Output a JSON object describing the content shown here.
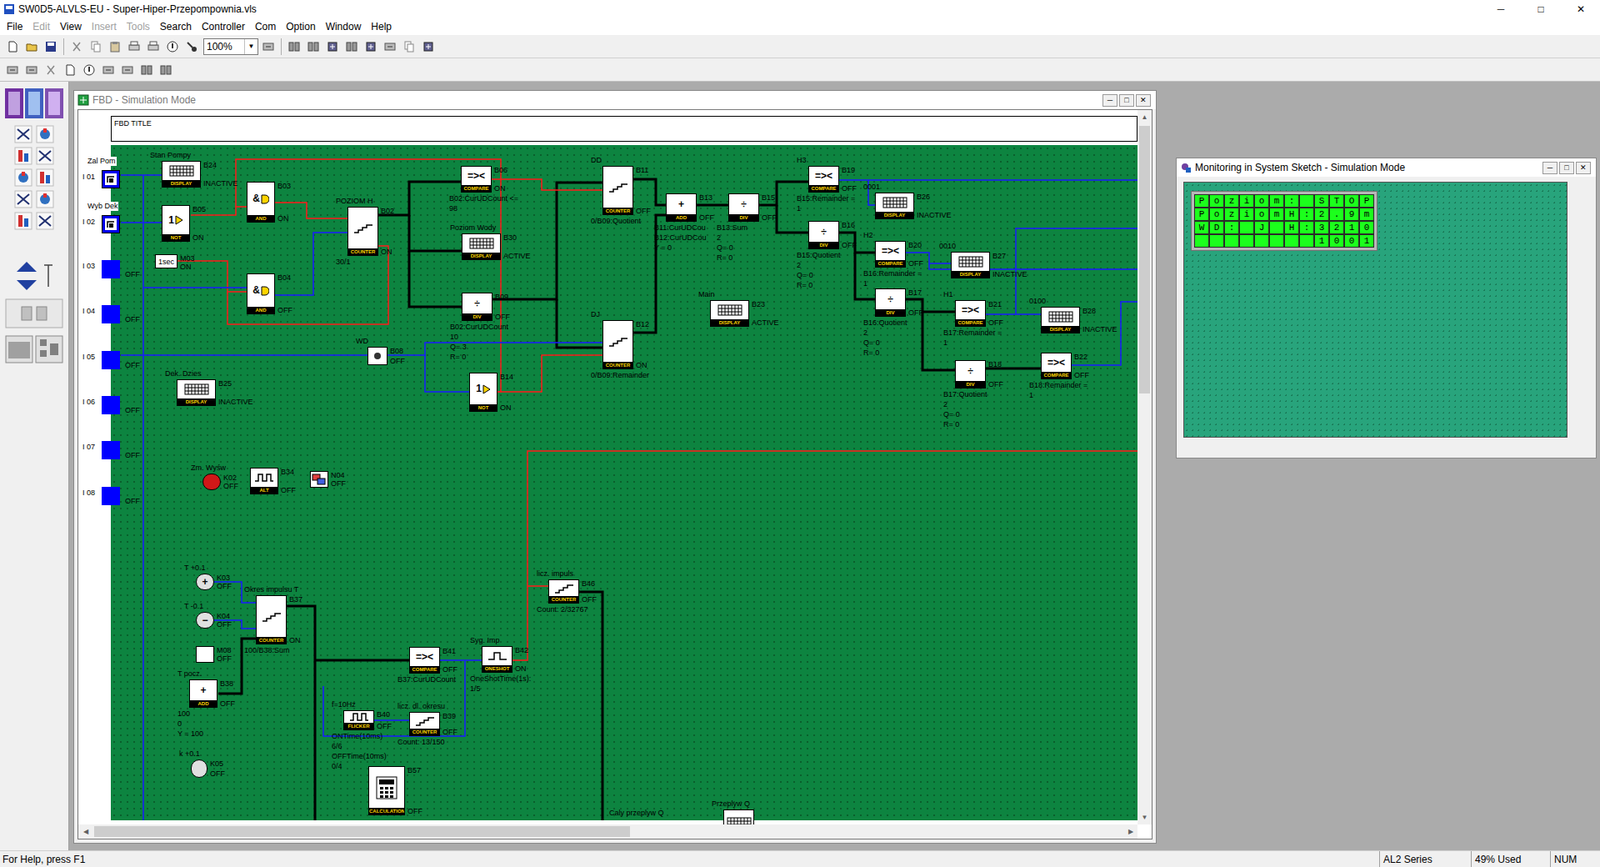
{
  "window": {
    "title": "SW0D5-ALVLS-EU - Super-Hiper-Przepompownia.vls",
    "controls": [
      "─",
      "□",
      "✕"
    ]
  },
  "menu": [
    {
      "label": "File",
      "disabled": false
    },
    {
      "label": "Edit",
      "disabled": true
    },
    {
      "label": "View",
      "disabled": false
    },
    {
      "label": "Insert",
      "disabled": true
    },
    {
      "label": "Tools",
      "disabled": true
    },
    {
      "label": "Search",
      "disabled": false
    },
    {
      "label": "Controller",
      "disabled": false
    },
    {
      "label": "Com",
      "disabled": false
    },
    {
      "label": "Option",
      "disabled": false
    },
    {
      "label": "Window",
      "disabled": false
    },
    {
      "label": "Help",
      "disabled": false
    }
  ],
  "toolbar": {
    "zoom": "100%",
    "zoom_arrow": "▼"
  },
  "fbd_window": {
    "title": "FBD - Simulation Mode",
    "controls": [
      "─",
      "□",
      "✕"
    ],
    "diagram_title": "FBD TITLE",
    "scroll_arrows": [
      "▲",
      "▼",
      "◀",
      "▶"
    ],
    "vertical_thumb": 0.39,
    "horizontal_thumb": 0.52,
    "inputs": [
      {
        "id": "I 01",
        "name": "Zal Pom",
        "kind": "switch"
      },
      {
        "id": "I 02",
        "name": "Wyb Dek",
        "kind": "switch"
      },
      {
        "id": "I 03",
        "kind": "plain",
        "state": "OFF"
      },
      {
        "id": "I 04",
        "kind": "plain",
        "state": "OFF"
      },
      {
        "id": "I 05",
        "kind": "plain",
        "state": "OFF"
      },
      {
        "id": "I 06",
        "kind": "plain",
        "state": "OFF"
      },
      {
        "id": "I 07",
        "kind": "plain",
        "state": "OFF"
      },
      {
        "id": "I 08",
        "kind": "plain",
        "state": "OFF"
      }
    ],
    "blocks": [
      {
        "id": "B24",
        "kind": "display",
        "caption": "Stan Pompy",
        "type": "DISPLAY",
        "state": "INACTIVE"
      },
      {
        "id": "B05",
        "kind": "not",
        "symbol": "1",
        "type": "NOT",
        "state": "ON"
      },
      {
        "id": "M03",
        "kind": "bit",
        "symbol": "1sec",
        "state": "ON"
      },
      {
        "id": "B03",
        "kind": "and",
        "symbol": "&",
        "type": "AND",
        "state": "ON"
      },
      {
        "id": "B04",
        "kind": "and",
        "symbol": "&",
        "type": "AND",
        "state": "OFF"
      },
      {
        "id": "B02",
        "kind": "counter",
        "caption": "POZIOM H",
        "type": "COUNTER",
        "state": "ON",
        "notes": [
          "30/1"
        ]
      },
      {
        "id": "B06",
        "kind": "compare",
        "symbol": "=><",
        "type": "COMPARE",
        "state": "ON",
        "notes": [
          "B02:CurUDCount <=",
          "98"
        ]
      },
      {
        "id": "B30",
        "kind": "display",
        "caption": "Poziom Wody",
        "type": "DISPLAY",
        "state": "ACTIVE"
      },
      {
        "id": "B09",
        "kind": "div",
        "symbol": "÷",
        "type": "DIV",
        "state": "OFF",
        "notes": [
          "B02:CurUDCount",
          "10",
          "Q= 3",
          "R= 0"
        ]
      },
      {
        "id": "B14",
        "kind": "not",
        "symbol": "1",
        "type": "NOT",
        "state": "ON"
      },
      {
        "id": "B08",
        "kind": "dot",
        "caption": "WD",
        "state": "OFF"
      },
      {
        "id": "B25",
        "kind": "display",
        "caption": "Dek. Dzies",
        "type": "DISPLAY",
        "state": "INACTIVE"
      },
      {
        "id": "B11",
        "kind": "counter",
        "caption": "DD",
        "type": "COUNTER",
        "state": "OFF",
        "notes": [
          "0/B09:Quotient"
        ]
      },
      {
        "id": "B12",
        "kind": "counter",
        "caption": "DJ",
        "type": "COUNTER",
        "state": "ON",
        "notes": [
          "0/B09:Remainder"
        ]
      },
      {
        "id": "B13",
        "kind": "add",
        "symbol": "+",
        "type": "ADD",
        "state": "OFF",
        "notes": [
          "B11:CurUDCou",
          "B12:CurUDCou",
          "Y = 0"
        ]
      },
      {
        "id": "B15",
        "kind": "div",
        "symbol": "÷",
        "type": "DIV",
        "state": "OFF",
        "notes": [
          "B13:Sum",
          "2",
          "Q= 0",
          "R= 0"
        ]
      },
      {
        "id": "B19",
        "kind": "compare",
        "caption": "H3",
        "symbol": "=><",
        "type": "COMPARE",
        "state": "OFF",
        "notes": [
          "B15:Remainder =",
          "1"
        ]
      },
      {
        "id": "B16",
        "kind": "div",
        "symbol": "÷",
        "type": "DIV",
        "state": "OFF",
        "notes": [
          "B15:Quotient",
          "2",
          "Q= 0",
          "R= 0"
        ]
      },
      {
        "id": "B26",
        "kind": "display",
        "caption": "0001",
        "type": "DISPLAY",
        "state": "INACTIVE"
      },
      {
        "id": "B20",
        "kind": "compare",
        "caption": "H2",
        "symbol": "=><",
        "type": "COMPARE",
        "state": "OFF",
        "notes": [
          "B16:Remainder =",
          "1"
        ]
      },
      {
        "id": "B17",
        "kind": "div",
        "symbol": "÷",
        "type": "DIV",
        "state": "OFF",
        "notes": [
          "B16:Quotient",
          "2",
          "Q= 0",
          "R= 0"
        ]
      },
      {
        "id": "B27",
        "kind": "display",
        "caption": "0010",
        "type": "DISPLAY",
        "state": "INACTIVE"
      },
      {
        "id": "B21",
        "kind": "compare",
        "caption": "H1",
        "symbol": "=><",
        "type": "COMPARE",
        "state": "OFF",
        "notes": [
          "B17:Remainder =",
          "1"
        ]
      },
      {
        "id": "B18",
        "kind": "div",
        "symbol": "÷",
        "type": "DIV",
        "state": "OFF",
        "notes": [
          "B17:Quotient",
          "2",
          "Q= 0",
          "R= 0"
        ]
      },
      {
        "id": "B28",
        "kind": "display",
        "caption": "0100",
        "type": "DISPLAY",
        "state": "INACTIVE"
      },
      {
        "id": "B22",
        "kind": "compare",
        "symbol": "=><",
        "type": "COMPARE",
        "state": "OFF",
        "notes": [
          "B18:Remainder =",
          "1"
        ]
      },
      {
        "id": "B23",
        "kind": "display",
        "caption": "Main",
        "type": "DISPLAY",
        "state": "ACTIVE"
      },
      {
        "id": "K02",
        "kind": "key-red",
        "caption": "Zm. Wyśw",
        "state": "OFF"
      },
      {
        "id": "B34",
        "kind": "alt",
        "type": "ALT",
        "state": "OFF"
      },
      {
        "id": "N04",
        "kind": "net",
        "state": "OFF"
      },
      {
        "id": "K03",
        "kind": "key",
        "caption": "T +0.1",
        "symbol": "+",
        "state": "OFF"
      },
      {
        "id": "K04",
        "kind": "key",
        "caption": "T -0.1",
        "symbol": "−",
        "state": "OFF"
      },
      {
        "id": "B37",
        "kind": "counter",
        "caption": "Okres impulsu T",
        "type": "COUNTER",
        "state": "ON",
        "notes": [
          "100/B38:Sum"
        ]
      },
      {
        "id": "M08",
        "kind": "bit",
        "state": "OFF"
      },
      {
        "id": "B38",
        "kind": "add",
        "caption": "T pocz.",
        "symbol": "+",
        "type": "ADD",
        "state": "OFF",
        "notes": [
          "100",
          "0",
          "Y = 100"
        ]
      },
      {
        "id": "K05",
        "kind": "key",
        "caption": "k +0.1",
        "state": "OFF"
      },
      {
        "id": "B41",
        "kind": "compare",
        "symbol": "=><",
        "type": "COMPARE",
        "state": "OFF",
        "notes": [
          "B37:CurUDCount"
        ]
      },
      {
        "id": "B42",
        "kind": "oneshot",
        "caption": "Syg. Imp",
        "type": "ONESHOT",
        "state": "ON",
        "notes": [
          "OneShotTime(1s):",
          "1/5"
        ]
      },
      {
        "id": "B40",
        "kind": "flicker",
        "caption": "f=10Hz",
        "type": "FLICKER",
        "state": "OFF",
        "notes": [
          "ONTime(10ms)",
          "6/6",
          "OFFTime(10ms)",
          "0/4"
        ]
      },
      {
        "id": "B39",
        "kind": "counter1",
        "caption": "licz. dl. okresu",
        "type": "COUNTER",
        "state": "OFF",
        "notes": [
          "Count: 13/150"
        ]
      },
      {
        "id": "B46",
        "kind": "counter1",
        "caption": "licz. impuls",
        "type": "COUNTER",
        "state": "OFF",
        "notes": [
          "Count: 2/32767"
        ]
      },
      {
        "id": "B57",
        "kind": "calc",
        "type": "CALCULATION",
        "state": "OFF"
      },
      {
        "kind": "display",
        "caption": "Przeplyw Q"
      }
    ],
    "labels": [
      {
        "text": "Caly przeplyw Q"
      }
    ],
    "wires": [
      {
        "from": "I 01",
        "to": "B24",
        "signal": "off"
      },
      {
        "from": "I 01",
        "to": "K05",
        "signal": "off"
      },
      {
        "from": "I 02",
        "to": "B05",
        "signal": "off"
      },
      {
        "from": "B05",
        "to": "B03",
        "signal": "on"
      },
      {
        "from": "M03",
        "to": "B04",
        "signal": "on"
      },
      {
        "from": "M03",
        "to": "B02",
        "signal": "on"
      },
      {
        "from": "B03",
        "to": "B14",
        "signal": "on"
      },
      {
        "from": "B03",
        "to": "B02",
        "signal": "on"
      },
      {
        "from": "B04",
        "to": "B02",
        "signal": "off"
      },
      {
        "from": "I 03",
        "to": "B04",
        "signal": "off"
      },
      {
        "from": "B02",
        "to": "B06",
        "signal": "word"
      },
      {
        "from": "B02",
        "to": "B30",
        "signal": "word"
      },
      {
        "from": "B02",
        "to": "B09",
        "signal": "word"
      },
      {
        "from": "B09",
        "to": "B11",
        "signal": "word"
      },
      {
        "from": "B09",
        "to": "B12",
        "signal": "word"
      },
      {
        "from": "B06",
        "to": "B11",
        "signal": "on"
      },
      {
        "from": "B14",
        "to": "B12",
        "signal": "on"
      },
      {
        "from": "I 05",
        "to": "B08",
        "signal": "off"
      },
      {
        "from": "B08",
        "to": "B12",
        "signal": "off"
      },
      {
        "from": "B08",
        "to": "B14",
        "signal": "off"
      },
      {
        "from": "B11",
        "to": "B13",
        "signal": "word"
      },
      {
        "from": "B12",
        "to": "B13",
        "signal": "word"
      },
      {
        "from": "B13",
        "to": "B15",
        "signal": "word"
      },
      {
        "from": "B15",
        "to": "B19",
        "signal": "word"
      },
      {
        "from": "B15",
        "to": "B16",
        "signal": "word"
      },
      {
        "from": "B16",
        "to": "B20",
        "signal": "word"
      },
      {
        "from": "B16",
        "to": "B17",
        "signal": "word"
      },
      {
        "from": "B17",
        "to": "B21",
        "signal": "word"
      },
      {
        "from": "B17",
        "to": "B18",
        "signal": "word"
      },
      {
        "from": "B18",
        "to": "B22",
        "signal": "word"
      },
      {
        "from": "B19",
        "to": "B26",
        "signal": "off"
      },
      {
        "from": "B19",
        "to": "O",
        "signal": "off"
      },
      {
        "from": "B20",
        "to": "B27",
        "signal": "off"
      },
      {
        "from": "B20",
        "to": "O",
        "signal": "off"
      },
      {
        "from": "B21",
        "to": "B28",
        "signal": "off"
      },
      {
        "from": "B21",
        "to": "O",
        "signal": "off"
      },
      {
        "from": "B22",
        "to": "O",
        "signal": "off"
      },
      {
        "from": "B42",
        "to": "B46",
        "signal": "on"
      },
      {
        "from": "B42",
        "to": "O",
        "signal": "on"
      },
      {
        "from": "B37",
        "to": "B57",
        "signal": "word"
      },
      {
        "from": "B37",
        "to": "B41",
        "signal": "word"
      },
      {
        "from": "B41",
        "to": "B42",
        "signal": "off"
      },
      {
        "from": "B46",
        "to": "O",
        "signal": "word"
      },
      {
        "from": "B40",
        "to": "B39",
        "signal": "off"
      },
      {
        "from": "B40",
        "to": "B41",
        "signal": "off"
      },
      {
        "from": "K03",
        "to": "B37",
        "signal": "off"
      },
      {
        "from": "K04",
        "to": "B37",
        "signal": "off"
      },
      {
        "from": "B38",
        "to": "B37",
        "signal": "word"
      }
    ]
  },
  "monitor_window": {
    "title": "Monitoring in System Sketch - Simulation Mode",
    "controls": [
      "─",
      "□",
      "✕"
    ],
    "lcd_rows": [
      "Poziom: STOP",
      "PoziomH:2.9m",
      "WD: J H:3210",
      "        1001"
    ]
  },
  "status_bar": {
    "help": "For Help, press F1",
    "series": "AL2 Series",
    "memory": "49% Used",
    "num": "NUM"
  }
}
